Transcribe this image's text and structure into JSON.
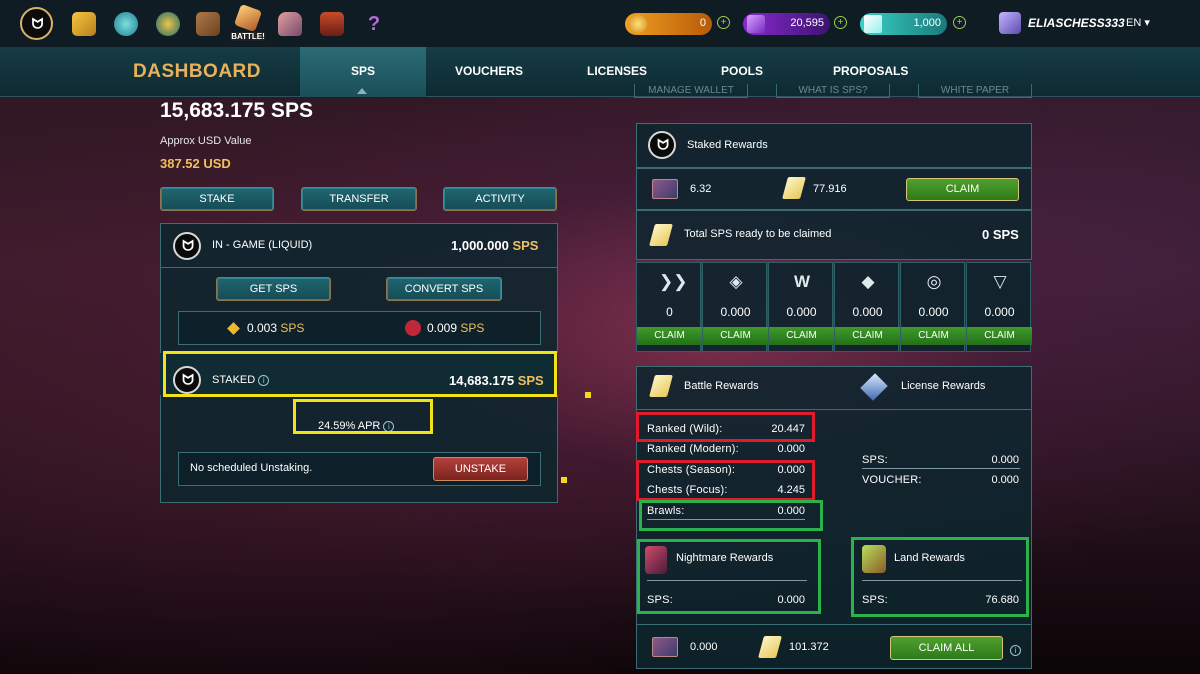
{
  "topbar": {
    "battle_label": "BATTLE!",
    "currencies": [
      {
        "name": "dec",
        "value": "0"
      },
      {
        "name": "vouchers",
        "value": "20,595"
      },
      {
        "name": "credits",
        "value": "1,000"
      }
    ],
    "username": "ELIASCHESS333",
    "language": "EN ▾"
  },
  "nav": {
    "title": "DASHBOARD",
    "tabs": [
      "SPS",
      "VOUCHERS",
      "LICENSES",
      "POOLS",
      "PROPOSALS"
    ],
    "active_tab": "SPS",
    "sub_buttons": [
      "MANAGE WALLET",
      "WHAT IS SPS?",
      "WHITE PAPER"
    ]
  },
  "balance": {
    "total": "15,683.175 SPS",
    "usd_label": "Approx USD Value",
    "usd_value": "387.52 USD",
    "actions": [
      "STAKE",
      "TRANSFER",
      "ACTIVITY"
    ]
  },
  "ingame": {
    "label": "IN - GAME (LIQUID)",
    "amount": "1,000.000",
    "unit": "SPS",
    "get_sps": "GET SPS",
    "convert_sps": "CONVERT SPS",
    "bsc_value": "0.003",
    "other_value": "0.009",
    "unit_small": "SPS"
  },
  "staked": {
    "label": "STAKED",
    "amount": "14,683.175",
    "unit": "SPS",
    "apr": "24.59% APR",
    "unstake_status": "No scheduled Unstaking.",
    "unstake_button": "UNSTAKE"
  },
  "staked_rewards": {
    "title": "Staked Rewards",
    "card_value": "6.32",
    "shard_value": "77.916",
    "claim": "CLAIM",
    "total_label": "Total SPS ready to be claimed",
    "total_value": "0 SPS"
  },
  "chains": [
    {
      "icon": "hive-icon",
      "value": "0",
      "claim": "CLAIM"
    },
    {
      "icon": "bsc-icon",
      "value": "0.000",
      "claim": "CLAIM"
    },
    {
      "icon": "wax-icon",
      "value": "0.000",
      "claim": "CLAIM"
    },
    {
      "icon": "ethereum-icon",
      "value": "0.000",
      "claim": "CLAIM"
    },
    {
      "icon": "steem-icon",
      "value": "0.000",
      "claim": "CLAIM"
    },
    {
      "icon": "tron-icon",
      "value": "0.000",
      "claim": "CLAIM"
    }
  ],
  "battle_rewards": {
    "title": "Battle Rewards",
    "rows": [
      {
        "label": "Ranked (Wild):",
        "value": "20.447"
      },
      {
        "label": "Ranked (Modern):",
        "value": "0.000"
      },
      {
        "label": "Chests (Season):",
        "value": "0.000"
      },
      {
        "label": "Chests (Focus):",
        "value": "4.245"
      },
      {
        "label": "Brawls:",
        "value": "0.000"
      }
    ]
  },
  "license_rewards": {
    "title": "License Rewards",
    "rows": [
      {
        "label": "SPS:",
        "value": "0.000"
      },
      {
        "label": "VOUCHER:",
        "value": "0.000"
      }
    ]
  },
  "nightmare_rewards": {
    "title": "Nightmare Rewards",
    "label": "SPS:",
    "value": "0.000"
  },
  "land_rewards": {
    "title": "Land Rewards",
    "label": "SPS:",
    "value": "76.680"
  },
  "footer": {
    "card_value": "0.000",
    "shard_value": "101.372",
    "claim_all": "CLAIM ALL"
  }
}
